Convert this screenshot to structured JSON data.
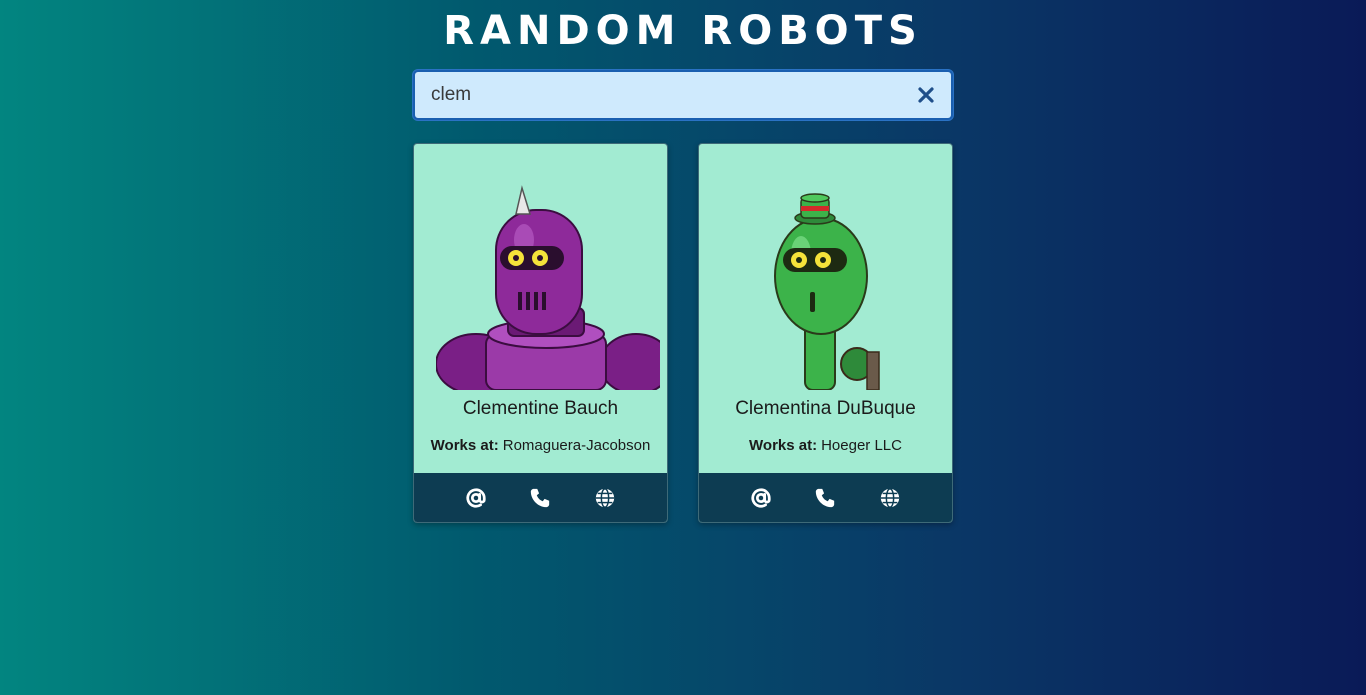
{
  "header": {
    "title": "RANDOM ROBOTS"
  },
  "search": {
    "value": "clem",
    "clear_icon": "close-icon"
  },
  "robots": [
    {
      "name": "Clementine Bauch",
      "works_label": "Works at:",
      "company": "Romaguera-Jacobson",
      "color": "#8e2a9a",
      "actions": [
        "at-sign-icon",
        "phone-icon",
        "globe-icon"
      ]
    },
    {
      "name": "Clementina DuBuque",
      "works_label": "Works at:",
      "company": "Hoeger LLC",
      "color": "#3cb34a",
      "actions": [
        "at-sign-icon",
        "phone-icon",
        "globe-icon"
      ]
    }
  ],
  "colors": {
    "card_bg": "#a2ebd2",
    "card_footer": "#0d3c52",
    "search_bg": "#cfeafd"
  }
}
